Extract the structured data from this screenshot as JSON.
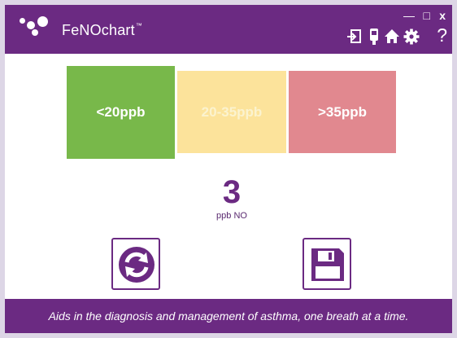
{
  "app": {
    "title": "FeNOchart",
    "trademark": "™"
  },
  "window_controls": {
    "minimize": "—",
    "maximize": "□",
    "close": "x"
  },
  "toolbar": {
    "icons": [
      "exit-icon",
      "device-icon",
      "home-icon",
      "settings-icon",
      "help-icon"
    ],
    "help_label": "?"
  },
  "ranges": [
    {
      "label": "<20ppb",
      "color": "#78b84a",
      "selected": true
    },
    {
      "label": "20-35ppb",
      "color": "#fce39b",
      "selected": false
    },
    {
      "label": ">35ppb",
      "color": "#e1888f",
      "selected": false
    }
  ],
  "reading": {
    "value": "3",
    "unit": "ppb NO"
  },
  "actions": {
    "refresh": "refresh-icon",
    "save": "save-icon"
  },
  "footer": {
    "tagline": "Aids in the diagnosis and management of asthma, one breath at a time."
  },
  "colors": {
    "brand": "#6b2a82",
    "low": "#78b84a",
    "mid": "#fce39b",
    "high": "#e1888f"
  }
}
